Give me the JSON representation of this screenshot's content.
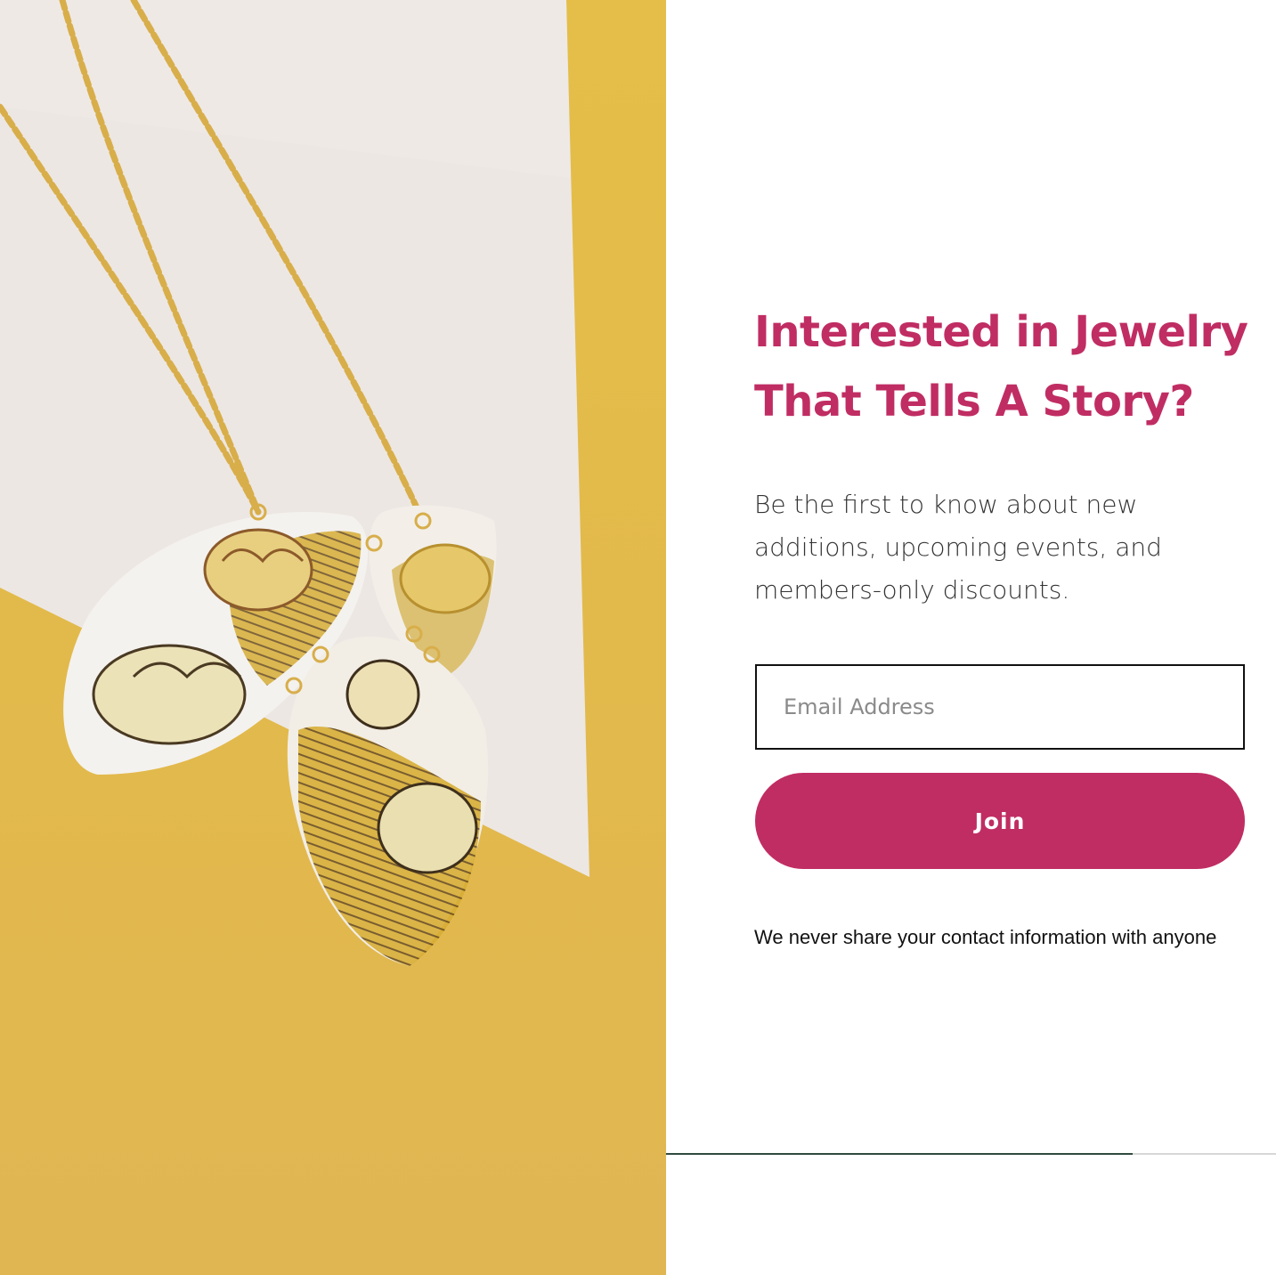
{
  "hero": {
    "image_description_icon": "necklace-photo"
  },
  "signup": {
    "headline": "Interested in Jewelry That Tells A Story?",
    "subtext": "Be the first to know about new additions, upcoming events, and members-only discounts.",
    "email_placeholder": "Email Address",
    "email_value": "",
    "join_label": "Join",
    "privacy_note": "We never share your contact information with anyone"
  },
  "progress": {
    "fraction": 0.765
  },
  "colors": {
    "accent": "#c02d63",
    "background_yellow": "#e2b94c",
    "card": "#ede7e3",
    "progress_fill": "#2f4a3e"
  }
}
